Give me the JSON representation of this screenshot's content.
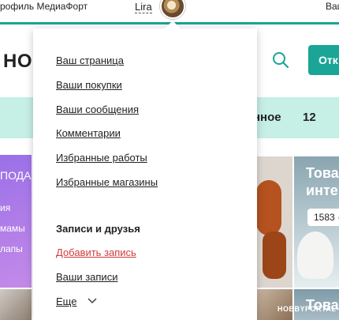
{
  "topbar": {
    "brand": "рофиль МедиаФорт",
    "username": "Lira",
    "right_text": "Ваш"
  },
  "header": {
    "logo_part": "НО",
    "cta_label": "Отк"
  },
  "mintbar": {
    "tail_text": "нное",
    "count": "12"
  },
  "content": {
    "purple_lines": [
      "ПОДА",
      "ия",
      "мамы",
      "лапы"
    ],
    "card_title": "Това инте",
    "card_chip": "1583 ·",
    "card2_title": "Това",
    "watermark": "HOBBYPORTAL"
  },
  "menu": {
    "items": [
      "Ваш страница",
      "Ваши покупки",
      "Ваши сообщения",
      "Комментарии",
      "Избранные работы",
      "Избранные магазины"
    ],
    "section_title": "Записи и друзья",
    "add_post": "Добавить запись",
    "my_posts": "Ваши записи",
    "more": "Еще"
  },
  "colors": {
    "accent_teal": "#1aa596",
    "mint": "#c6efe6",
    "link_red": "#d23b3b"
  }
}
